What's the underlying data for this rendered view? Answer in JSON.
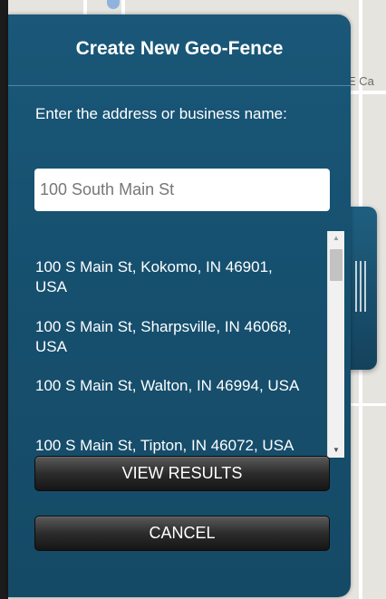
{
  "map": {
    "road_label": "E Ca"
  },
  "panel": {
    "title": "Create New Geo-Fence",
    "prompt": "Enter the address or business name:",
    "search": {
      "value": "100 South Main St",
      "placeholder": ""
    },
    "results": [
      "100 S Main St, Kokomo, IN 46901, USA",
      "100 S Main St, Sharpsville, IN 46068, USA",
      "100 S Main St, Walton, IN 46994, USA",
      "100 S Main St, Tipton, IN 46072, USA"
    ],
    "view_results_label": "VIEW RESULTS",
    "cancel_label": "CANCEL"
  },
  "icons": {
    "scroll_up": "scroll-up-arrow-icon",
    "scroll_down": "scroll-down-arrow-icon",
    "grip": "grip-lines-icon"
  },
  "colors": {
    "panel": "#1a5778",
    "button": "#2c2c2c",
    "text": "#ffffff"
  }
}
